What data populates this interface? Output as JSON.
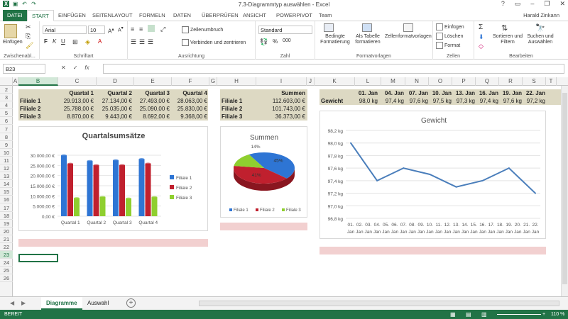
{
  "window": {
    "title": "7.3-Diagrammtyp auswählen - Excel",
    "user": "Harald Zinkann"
  },
  "ribbon_tabs": [
    "DATEI",
    "START",
    "EINFÜGEN",
    "SEITENLAYOUT",
    "FORMELN",
    "DATEN",
    "ÜBERPRÜFEN",
    "ANSICHT",
    "POWERPIVOT",
    "Team"
  ],
  "ribbon": {
    "clipboard": {
      "paste": "Einfügen",
      "label": "Zwischenabl..."
    },
    "font": {
      "name": "Arial",
      "size": "10",
      "label": "Schriftart",
      "bold": "F",
      "italic": "K",
      "underline": "U"
    },
    "alignment": {
      "wrap": "Zeilenumbruch",
      "merge": "Verbinden und zentrieren",
      "label": "Ausrichtung"
    },
    "number": {
      "format": "Standard",
      "label": "Zahl",
      "percent": "%",
      "thousands": "000"
    },
    "styles": {
      "conditional": "Bedingte Formatierung",
      "as_table": "Als Tabelle formatieren",
      "cell_styles": "Zellenformatvorlagen",
      "label": "Formatvorlagen"
    },
    "cells": {
      "insert": "Einfügen",
      "delete": "Löschen",
      "format": "Format",
      "label": "Zellen"
    },
    "editing": {
      "sort": "Sortieren und Filtern",
      "find": "Suchen und Auswählen",
      "label": "Bearbeiten"
    }
  },
  "formula_bar": {
    "namebox": "B23",
    "fx": "fx",
    "value": ""
  },
  "columns": [
    "A",
    "B",
    "C",
    "D",
    "E",
    "F",
    "G",
    "H",
    "I",
    "J",
    "K",
    "L",
    "M",
    "N",
    "O",
    "P",
    "Q",
    "R",
    "S",
    "T"
  ],
  "rows": [
    "2",
    "3",
    "4",
    "5",
    "6",
    "7",
    "8",
    "9",
    "10",
    "11",
    "12",
    "13",
    "14",
    "15",
    "16",
    "17",
    "18",
    "19",
    "20",
    "21",
    "22",
    "23",
    "24",
    "25",
    "26"
  ],
  "table1": {
    "headers": [
      "Quartal 1",
      "Quartal 2",
      "Quartal 3",
      "Quartal 4"
    ],
    "rows": [
      {
        "label": "Filiale 1",
        "values": [
          "29.913,00 €",
          "27.134,00 €",
          "27.493,00 €",
          "28.063,00 €"
        ]
      },
      {
        "label": "Filiale 2",
        "values": [
          "25.788,00 €",
          "25.035,00 €",
          "25.090,00 €",
          "25.830,00 €"
        ]
      },
      {
        "label": "Filiale 3",
        "values": [
          "8.870,00 €",
          "9.443,00 €",
          "8.692,00 €",
          "9.368,00 €"
        ]
      }
    ]
  },
  "table2": {
    "header": "Summen",
    "rows": [
      {
        "label": "Filiale 1",
        "value": "112.603,00 €"
      },
      {
        "label": "Filiale 2",
        "value": "101.743,00 €"
      },
      {
        "label": "Filiale 3",
        "value": "36.373,00 €"
      }
    ]
  },
  "table3": {
    "headers": [
      "01. Jan",
      "04. Jan",
      "07. Jan",
      "10. Jan",
      "13. Jan",
      "16. Jan",
      "19. Jan",
      "22. Jan"
    ],
    "label": "Gewicht",
    "values": [
      "98,0 kg",
      "97,4 kg",
      "97,6 kg",
      "97,5 kg",
      "97,3 kg",
      "97,4 kg",
      "97,6 kg",
      "97,2 kg"
    ]
  },
  "chart_data": [
    {
      "type": "bar",
      "title": "Quartalsumsätze",
      "categories": [
        "Quartal 1",
        "Quartal 2",
        "Quartal 3",
        "Quartal 4"
      ],
      "series": [
        {
          "name": "Filiale 1",
          "values": [
            29913,
            27134,
            27493,
            28063
          ],
          "color": "#2e75d4"
        },
        {
          "name": "Filiale 2",
          "values": [
            25788,
            25035,
            25090,
            25830
          ],
          "color": "#c0202e"
        },
        {
          "name": "Filiale 3",
          "values": [
            8870,
            9443,
            8692,
            9368
          ],
          "color": "#8fcf2f"
        }
      ],
      "yticks": [
        "0,00 €",
        "5.000,00 €",
        "10.000,00 €",
        "15.000,00 €",
        "20.000,00 €",
        "25.000,00 €",
        "30.000,00 €"
      ],
      "ylim": [
        0,
        30000
      ],
      "legend": "right"
    },
    {
      "type": "pie",
      "title": "Summen",
      "categories": [
        "Filiale 1",
        "Filiale 2",
        "Filiale 3"
      ],
      "values": [
        112603,
        101743,
        36373
      ],
      "labels": [
        "45%",
        "41%",
        "14%"
      ],
      "colors": [
        "#2e75d4",
        "#c0202e",
        "#8fcf2f"
      ],
      "legend": "bottom"
    },
    {
      "type": "line",
      "title": "Gewicht",
      "categories": [
        "01. Jan",
        "02. Jan",
        "03. Jan",
        "04. Jan",
        "05. Jan",
        "06. Jan",
        "07. Jan",
        "08. Jan",
        "09. Jan",
        "10. Jan",
        "11. Jan",
        "12. Jan",
        "13. Jan",
        "14. Jan",
        "15. Jan",
        "16. Jan",
        "17. Jan",
        "18. Jan",
        "19. Jan",
        "20. Jan",
        "21. Jan",
        "22. Jan"
      ],
      "xticks_top": [
        "01.",
        "02.",
        "03.",
        "04.",
        "05.",
        "06.",
        "07.",
        "08.",
        "09.",
        "10.",
        "11.",
        "12.",
        "13.",
        "14.",
        "15.",
        "16.",
        "17.",
        "18.",
        "19.",
        "20.",
        "21.",
        "22."
      ],
      "xticks_bottom": "Jan",
      "points": [
        [
          1,
          98.0
        ],
        [
          4,
          97.4
        ],
        [
          7,
          97.6
        ],
        [
          10,
          97.5
        ],
        [
          13,
          97.3
        ],
        [
          16,
          97.4
        ],
        [
          19,
          97.6
        ],
        [
          22,
          97.2
        ]
      ],
      "yticks": [
        "96,8 kg",
        "97,0 kg",
        "97,2 kg",
        "97,4 kg",
        "97,6 kg",
        "97,8 kg",
        "98,0 kg",
        "98,2 kg"
      ],
      "ylim": [
        96.8,
        98.2
      ],
      "color": "#4a7ebb"
    }
  ],
  "sheets": [
    "Diagramme",
    "Auswahl"
  ],
  "status": {
    "mode": "BEREIT",
    "zoom": "110 %"
  }
}
